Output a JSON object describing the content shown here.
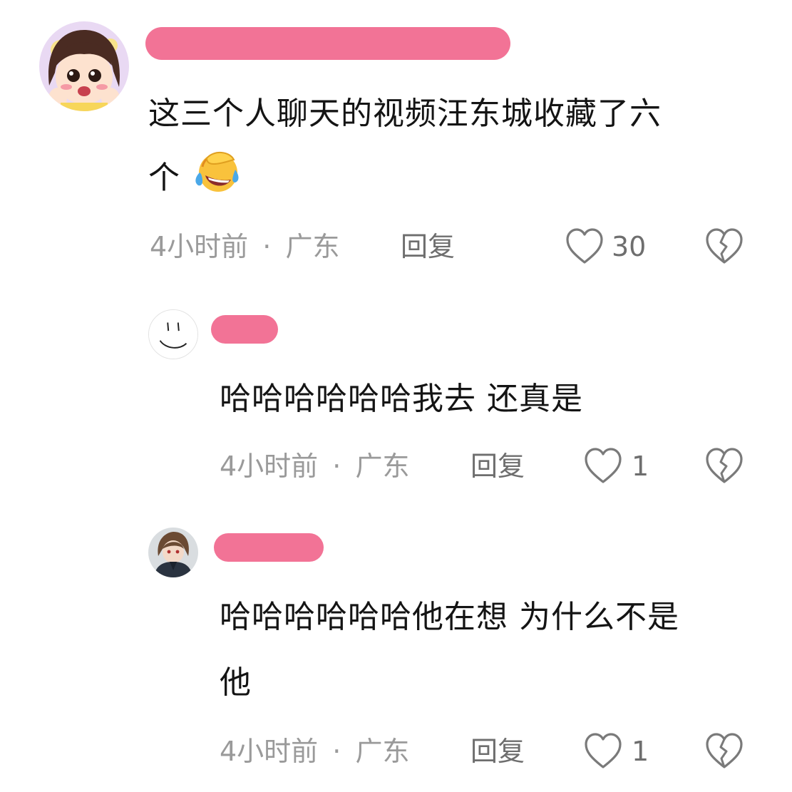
{
  "comments": [
    {
      "text_line1": "这三个人聊天的视频汪东城收藏了六",
      "text_line2": "个",
      "emoji_icon": "face-with-tears-of-joy-icon",
      "time": "4小时前",
      "location": "广东",
      "reply_label": "回复",
      "likes": "30"
    },
    {
      "text_line1": "哈哈哈哈哈哈我去 还真是",
      "time": "4小时前",
      "location": "广东",
      "reply_label": "回复",
      "likes": "1"
    },
    {
      "text_line1": "哈哈哈哈哈哈他在想 为什么不是",
      "text_line2": "他",
      "time": "4小时前",
      "location": "广东",
      "reply_label": "回复",
      "likes": "1"
    }
  ],
  "meta_separator": "·",
  "icons": {
    "like": "heart-outline-icon",
    "dislike": "broken-heart-icon"
  },
  "colors": {
    "redaction": "#f27396",
    "meta_text": "#9a9a9a",
    "action_text": "#6e6e6e"
  }
}
